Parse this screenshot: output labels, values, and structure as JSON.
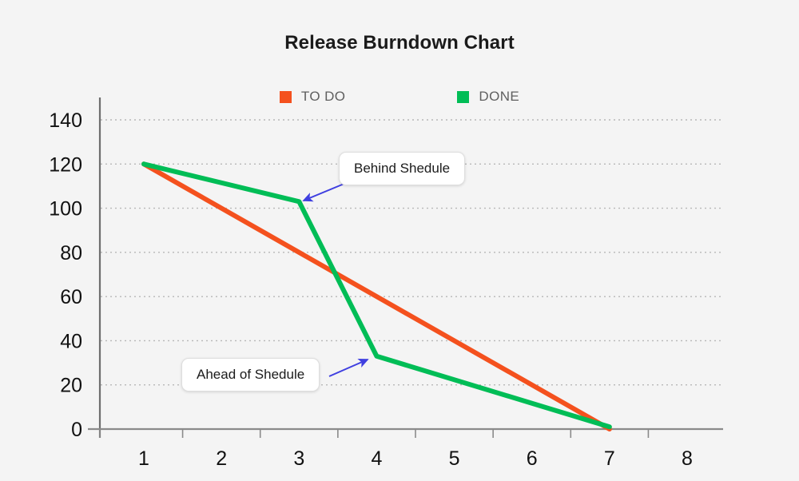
{
  "chart": {
    "title": "Release Burndown Chart",
    "background_color": "#f4f4f4"
  },
  "legend": {
    "position": "top-center",
    "items": [
      {
        "label": "TO DO",
        "color": "#f4511e",
        "icon": "square-swatch-icon"
      },
      {
        "label": "DONE",
        "color": "#00bd56",
        "icon": "square-swatch-icon"
      }
    ]
  },
  "annotations": [
    {
      "id": "behind",
      "text": "Behind Shedule",
      "arrow_color": "#3f3fe0",
      "points_to": {
        "x": 3,
        "y": 103
      }
    },
    {
      "id": "ahead",
      "text": "Ahead of Shedule",
      "arrow_color": "#3f3fe0",
      "points_to": {
        "x": 4,
        "y": 33
      }
    }
  ],
  "axes": {
    "y_ticks": [
      "0",
      "20",
      "40",
      "60",
      "80",
      "100",
      "120",
      "140"
    ],
    "x_ticks": [
      "1",
      "2",
      "3",
      "4",
      "5",
      "6",
      "7",
      "8"
    ]
  },
  "chart_data": {
    "type": "line",
    "title": "Release Burndown Chart",
    "xlabel": "",
    "ylabel": "",
    "x": [
      1,
      2,
      3,
      4,
      5,
      6,
      7,
      8
    ],
    "xlim": [
      1,
      8
    ],
    "ylim": [
      0,
      140
    ],
    "grid": true,
    "legend_position": "top-center",
    "series": [
      {
        "name": "TO DO",
        "color": "#f4511e",
        "points": [
          {
            "x": 1,
            "y": 120
          },
          {
            "x": 7,
            "y": 0
          }
        ]
      },
      {
        "name": "DONE",
        "color": "#00bd56",
        "points": [
          {
            "x": 1,
            "y": 120
          },
          {
            "x": 3,
            "y": 103
          },
          {
            "x": 4,
            "y": 33
          },
          {
            "x": 7,
            "y": 1
          }
        ]
      }
    ],
    "annotations": [
      {
        "text": "Behind Shedule",
        "x": 3,
        "y": 103
      },
      {
        "text": "Ahead of Shedule",
        "x": 4,
        "y": 33
      }
    ]
  }
}
